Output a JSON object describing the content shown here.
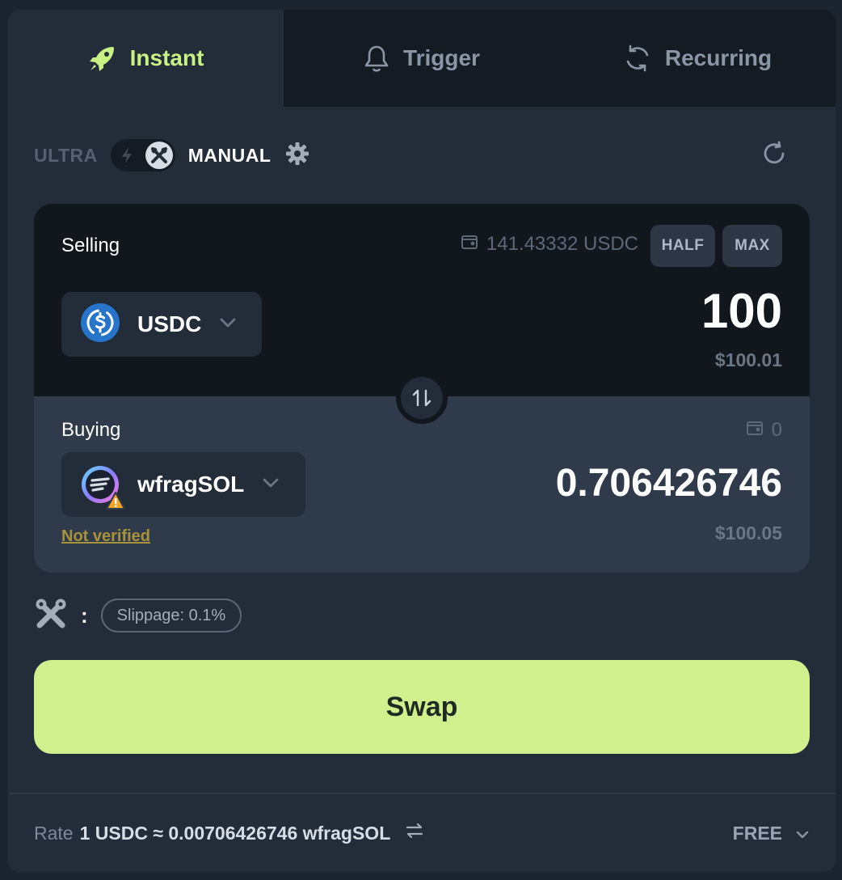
{
  "tabs": [
    {
      "label": "Instant",
      "icon": "rocket-icon"
    },
    {
      "label": "Trigger",
      "icon": "bell-icon"
    },
    {
      "label": "Recurring",
      "icon": "recurring-icon"
    }
  ],
  "mode": {
    "left_label": "ULTRA",
    "right_label": "MANUAL"
  },
  "selling": {
    "label": "Selling",
    "balance": "141.43332 USDC",
    "half_label": "HALF",
    "max_label": "MAX",
    "token": "USDC",
    "amount": "100",
    "usd_value": "$100.01"
  },
  "buying": {
    "label": "Buying",
    "balance": "0",
    "token": "wfragSOL",
    "amount": "0.706426746",
    "usd_value": "$100.05",
    "warning": "Not verified"
  },
  "slippage": {
    "separator": ":",
    "label": "Slippage: 0.1%"
  },
  "swap_button": "Swap",
  "rate": {
    "label": "Rate",
    "value": "1 USDC ≈ 0.00706426746 wfragSOL"
  },
  "fee": {
    "label": "FREE"
  },
  "colors": {
    "accent": "#c8f284",
    "swap_button": "#d0f08e",
    "warning": "#a8923a",
    "usdc_blue": "#2775ca"
  }
}
